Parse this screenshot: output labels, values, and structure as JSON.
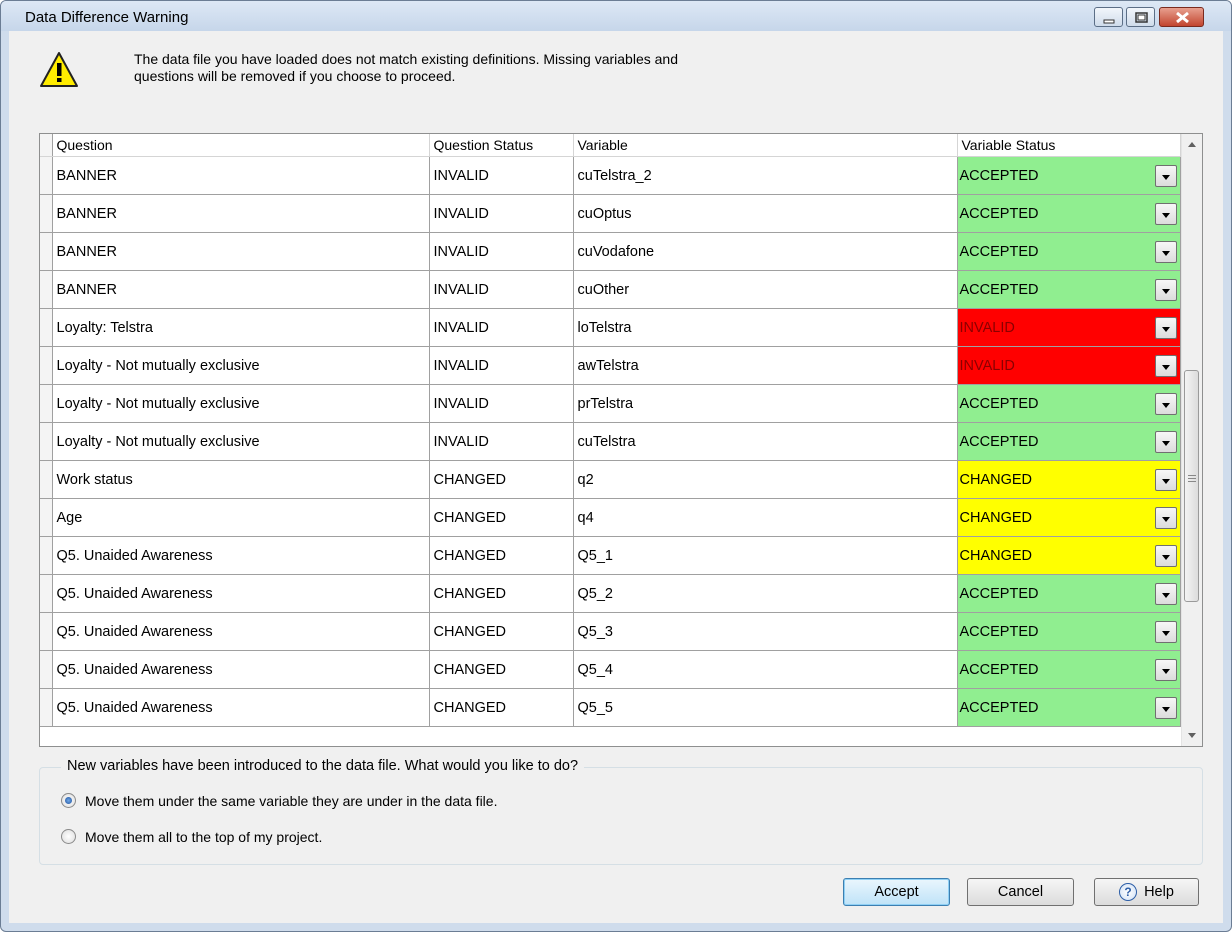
{
  "window": {
    "title": "Data Difference Warning",
    "controls": {
      "minimize": "minimize-icon",
      "maximize": "maximize-icon",
      "close": "close-icon"
    }
  },
  "warning": {
    "icon": "warning-icon",
    "message": "The data file you have loaded does not match existing definitions. Missing variables and questions will be removed if you choose to proceed."
  },
  "table": {
    "headers": [
      "Question",
      "Question Status",
      "Variable",
      "Variable Status"
    ],
    "rows": [
      {
        "question": "BANNER",
        "question_status": "INVALID",
        "variable": "cuTelstra_2",
        "variable_status": "ACCEPTED"
      },
      {
        "question": "BANNER",
        "question_status": "INVALID",
        "variable": "cuOptus",
        "variable_status": "ACCEPTED"
      },
      {
        "question": "BANNER",
        "question_status": "INVALID",
        "variable": "cuVodafone",
        "variable_status": "ACCEPTED"
      },
      {
        "question": "BANNER",
        "question_status": "INVALID",
        "variable": "cuOther",
        "variable_status": "ACCEPTED"
      },
      {
        "question": "Loyalty: Telstra",
        "question_status": "INVALID",
        "variable": "loTelstra",
        "variable_status": "INVALID"
      },
      {
        "question": "Loyalty - Not mutually exclusive",
        "question_status": "INVALID",
        "variable": "awTelstra",
        "variable_status": "INVALID"
      },
      {
        "question": "Loyalty - Not mutually exclusive",
        "question_status": "INVALID",
        "variable": "prTelstra",
        "variable_status": "ACCEPTED"
      },
      {
        "question": "Loyalty - Not mutually exclusive",
        "question_status": "INVALID",
        "variable": "cuTelstra",
        "variable_status": "ACCEPTED"
      },
      {
        "question": "Work status",
        "question_status": "CHANGED",
        "variable": "q2",
        "variable_status": "CHANGED"
      },
      {
        "question": "Age",
        "question_status": "CHANGED",
        "variable": "q4",
        "variable_status": "CHANGED"
      },
      {
        "question": "Q5. Unaided Awareness",
        "question_status": "CHANGED",
        "variable": "Q5_1",
        "variable_status": "CHANGED"
      },
      {
        "question": "Q5. Unaided Awareness",
        "question_status": "CHANGED",
        "variable": "Q5_2",
        "variable_status": "ACCEPTED"
      },
      {
        "question": "Q5. Unaided Awareness",
        "question_status": "CHANGED",
        "variable": "Q5_3",
        "variable_status": "ACCEPTED"
      },
      {
        "question": "Q5. Unaided Awareness",
        "question_status": "CHANGED",
        "variable": "Q5_4",
        "variable_status": "ACCEPTED"
      },
      {
        "question": "Q5. Unaided Awareness",
        "question_status": "CHANGED",
        "variable": "Q5_5",
        "variable_status": "ACCEPTED"
      }
    ],
    "status_colors": {
      "ACCEPTED": "#90ee90",
      "INVALID": "#ff0000",
      "CHANGED": "#ffff00"
    }
  },
  "options": {
    "legend": "New variables have been introduced to the data file.  What would you like to do?",
    "choices": [
      {
        "label": "Move them under the same variable they are under in the data file.",
        "selected": true
      },
      {
        "label": "Move them all to the top of my project.",
        "selected": false
      }
    ]
  },
  "buttons": {
    "accept": "Accept",
    "cancel": "Cancel",
    "help": "Help",
    "help_icon": "help-icon"
  }
}
